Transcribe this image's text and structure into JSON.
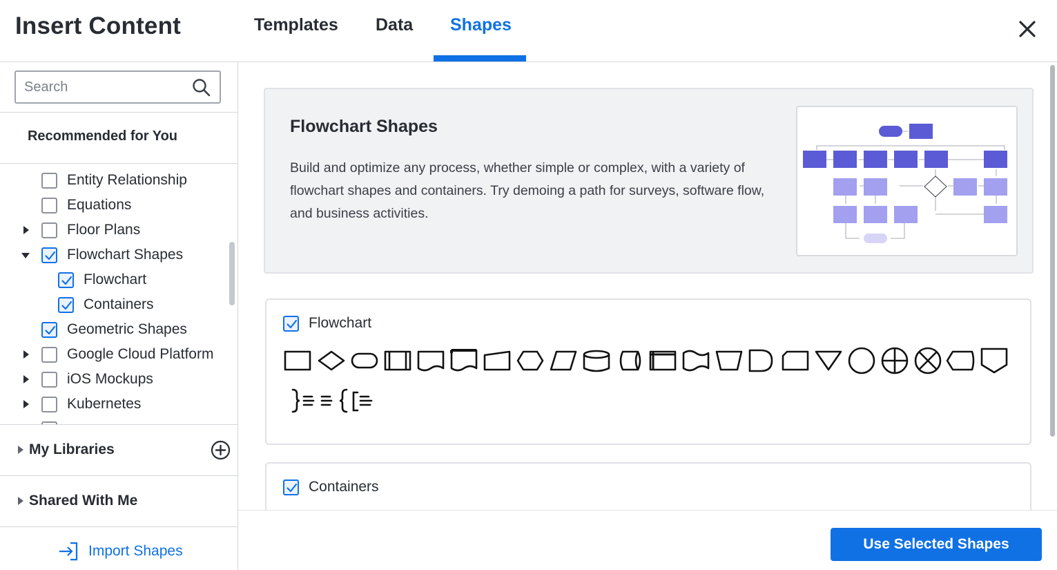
{
  "header": {
    "title": "Insert Content",
    "tabs": [
      {
        "label": "Templates",
        "active": false
      },
      {
        "label": "Data",
        "active": false
      },
      {
        "label": "Shapes",
        "active": true
      }
    ],
    "close_icon": "close-icon"
  },
  "sidebar": {
    "search": {
      "placeholder": "Search",
      "value": ""
    },
    "recommended_title": "Recommended for You",
    "items": [
      {
        "label": "Entity Relationship",
        "checked": false,
        "expandable": false
      },
      {
        "label": "Equations",
        "checked": false,
        "expandable": false
      },
      {
        "label": "Floor Plans",
        "checked": false,
        "expandable": true,
        "expanded": false
      },
      {
        "label": "Flowchart Shapes",
        "checked": true,
        "expandable": true,
        "expanded": true
      },
      {
        "label": "Flowchart",
        "checked": true,
        "child": true
      },
      {
        "label": "Containers",
        "checked": true,
        "child": true
      },
      {
        "label": "Geometric Shapes",
        "checked": true,
        "expandable": false
      },
      {
        "label": "Google Cloud Platform",
        "checked": false,
        "expandable": true,
        "expanded": false
      },
      {
        "label": "iOS Mockups",
        "checked": false,
        "expandable": true,
        "expanded": false
      },
      {
        "label": "Kubernetes",
        "checked": false,
        "expandable": true,
        "expanded": false
      }
    ],
    "my_libraries": "My Libraries",
    "shared_with_me": "Shared With Me",
    "import_shapes": "Import Shapes"
  },
  "main": {
    "feature": {
      "title": "Flowchart Shapes",
      "description": "Build and optimize any process, whether simple or complex, with a variety of flowchart shapes and containers. Try demoing a path for surveys, software flow, and business activities."
    },
    "libraries": [
      {
        "label": "Flowchart",
        "checked": true
      },
      {
        "label": "Containers",
        "checked": true
      }
    ]
  },
  "footer": {
    "use_button": "Use Selected Shapes"
  },
  "colors": {
    "accent": "#1071e5",
    "text": "#282c33",
    "preview_shape": "#5b5bd6",
    "preview_shape_light": "#a3a0f0"
  }
}
